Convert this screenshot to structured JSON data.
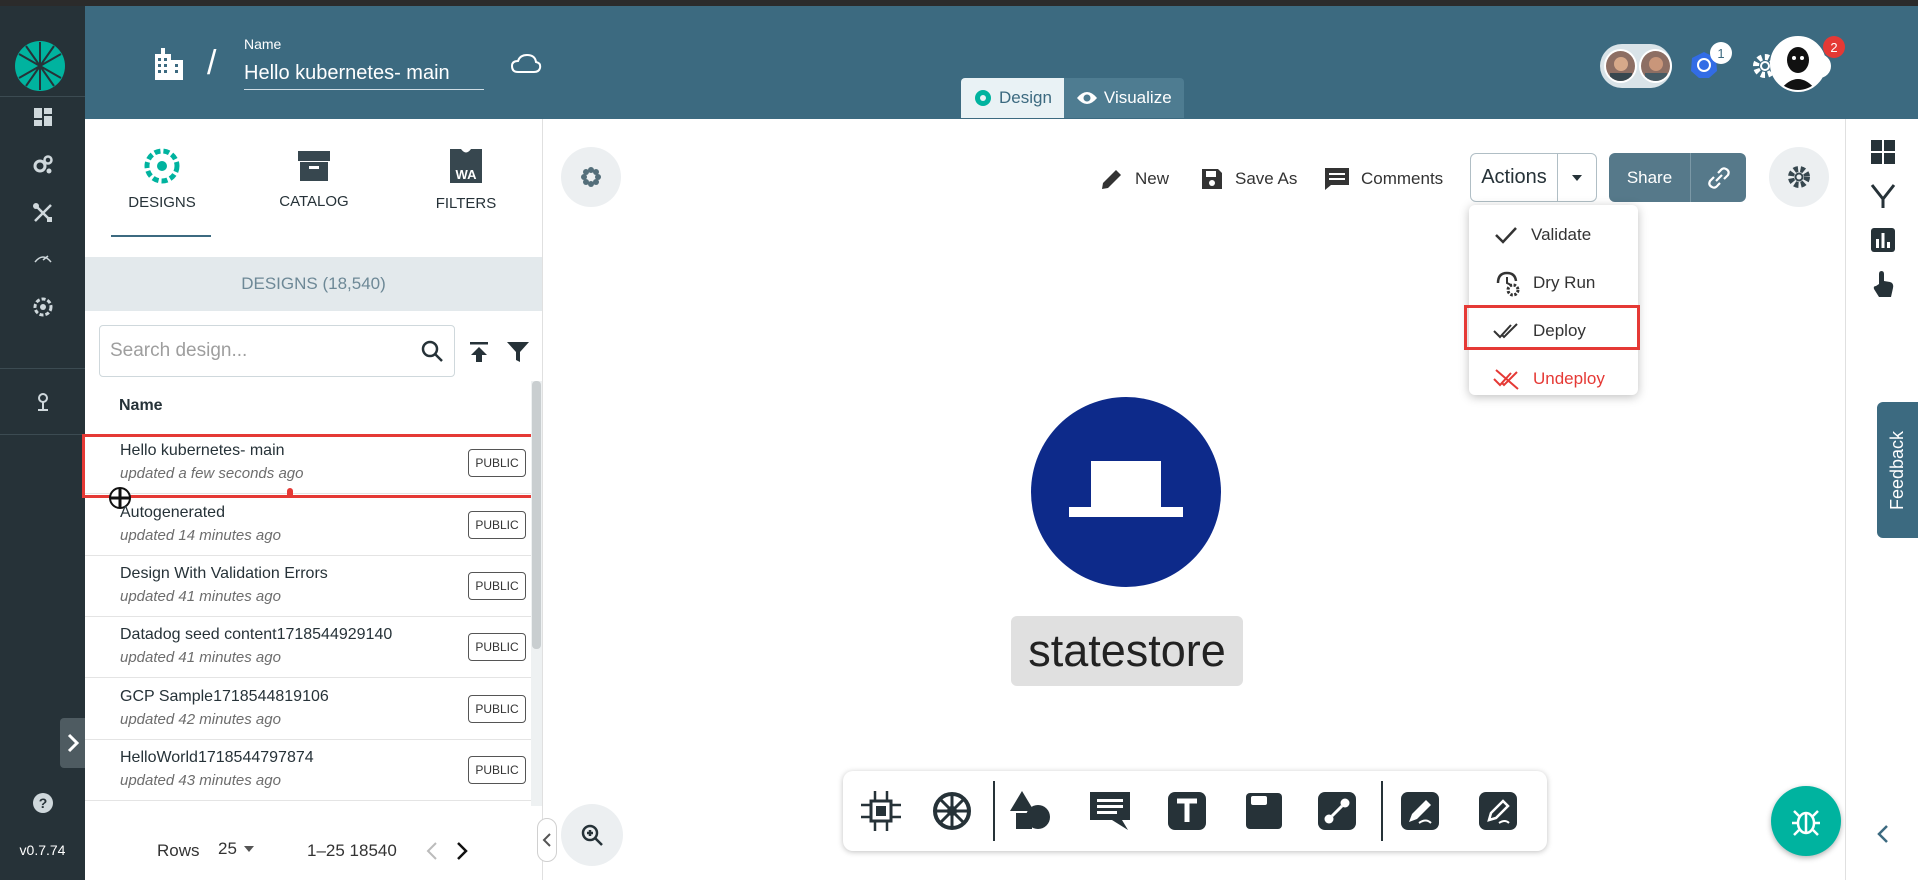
{
  "app": {
    "version": "v0.7.74"
  },
  "header": {
    "name_label": "Name",
    "design_name": "Hello kubernetes- main",
    "modes": [
      {
        "label": "Design",
        "active": true
      },
      {
        "label": "Visualize",
        "active": false
      }
    ],
    "kubernetes_badge": "1",
    "notifications_badge": "2"
  },
  "panel": {
    "tabs": [
      {
        "label": "DESIGNS",
        "active": true
      },
      {
        "label": "CATALOG",
        "active": false
      },
      {
        "label": "FILTERS",
        "active": false
      }
    ],
    "filters_icon_text": "WA",
    "designs_count_label": "DESIGNS (18,540)",
    "search_placeholder": "Search design...",
    "column_header": "Name",
    "rows": [
      {
        "title": "Hello kubernetes- main",
        "updated": "updated a few seconds ago",
        "visibility": "PUBLIC",
        "highlighted": true
      },
      {
        "title": "Autogenerated",
        "updated": "updated 14 minutes ago",
        "visibility": "PUBLIC"
      },
      {
        "title": "Design With Validation Errors",
        "updated": "updated 41 minutes ago",
        "visibility": "PUBLIC"
      },
      {
        "title": "Datadog seed content1718544929140",
        "updated": "updated 41 minutes ago",
        "visibility": "PUBLIC"
      },
      {
        "title": "GCP Sample1718544819106",
        "updated": "updated 42 minutes ago",
        "visibility": "PUBLIC"
      },
      {
        "title": "HelloWorld1718544797874",
        "updated": "updated 43 minutes ago",
        "visibility": "PUBLIC"
      }
    ],
    "pager": {
      "rows_label": "Rows",
      "rows_value": "25",
      "range": "1–25 18540"
    }
  },
  "toolbar": {
    "new_label": "New",
    "save_as_label": "Save As",
    "comments_label": "Comments",
    "actions_label": "Actions",
    "share_label": "Share"
  },
  "actions_menu": [
    {
      "label": "Validate",
      "color": "#333333"
    },
    {
      "label": "Dry Run",
      "color": "#333333"
    },
    {
      "label": "Deploy",
      "color": "#333333",
      "highlighted": true
    },
    {
      "label": "Undeploy",
      "color": "#e53935"
    }
  ],
  "canvas": {
    "node_label": "statestore"
  },
  "feedback_label": "Feedback",
  "colors": {
    "header": "#3c6a80",
    "rail": "#263238",
    "accent": "#00b39f",
    "highlight": "#e53935",
    "node": "#0d2a8a"
  }
}
